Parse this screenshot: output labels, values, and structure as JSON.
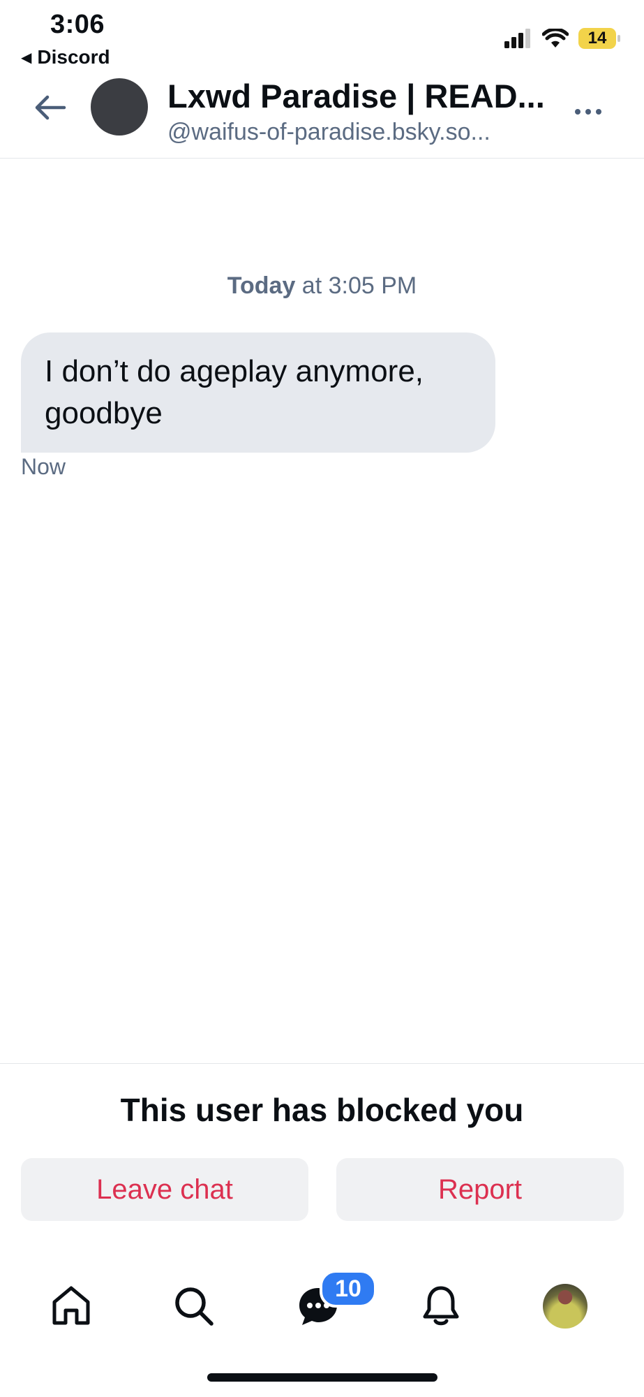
{
  "status_bar": {
    "time": "3:06",
    "back_app": "Discord",
    "battery": "14"
  },
  "header": {
    "title": "Lxwd Paradise | READ...",
    "handle": "@waifus-of-paradise.bsky.so..."
  },
  "messages": {
    "date_bold": "Today",
    "date_rest": " at 3:05 PM",
    "items": [
      {
        "text": "I don’t do ageplay anymore, goodbye",
        "time": "Now"
      }
    ]
  },
  "blocked": {
    "notice": "This user has blocked you",
    "leave_label": "Leave chat",
    "report_label": "Report"
  },
  "nav": {
    "chat_badge": "10",
    "items": [
      "home-icon",
      "search-icon",
      "chat-icon",
      "bell-icon",
      "profile-avatar"
    ]
  },
  "colors": {
    "accent_red": "#dc3050",
    "badge_blue": "#2f7bf2",
    "muted_text": "#5b6b82",
    "bubble_bg": "#e6e9ee"
  }
}
